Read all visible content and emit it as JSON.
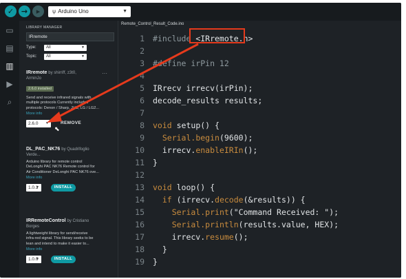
{
  "toolbar": {
    "board": "Arduino Uno",
    "verify_icon": "check-icon",
    "upload_icon": "arrow-right-icon",
    "debug_icon": "debug-icon"
  },
  "activity_bar": {
    "icons": [
      "folder-icon",
      "boards-icon",
      "library-icon",
      "debug-icon",
      "search-icon"
    ]
  },
  "library_manager": {
    "title": "LIBRARY MANAGER",
    "search_value": "IRremote",
    "type_label": "Type:",
    "type_value": "All",
    "topic_label": "Topic:",
    "topic_value": "All",
    "items": [
      {
        "name": "IRremote",
        "by": "by shirriff, z3t0,",
        "author2": "ArminJo",
        "badge": "2.6.0 installed",
        "desc1": "Send and receive infrared signals with",
        "desc2": "multiple protocols Currently included",
        "desc3": "protocols: Denon / Sharp, JVC, LG / LG2...",
        "more_info": "More info",
        "version": "2.6.0",
        "action": "REMOVE"
      },
      {
        "name": "DL_PAC_NK76",
        "by": "by Quadrifoglio",
        "author2": "Verde...",
        "desc1": "Arduino library for remote control",
        "desc2": "DeLonghi PAC NK76 Remote control for",
        "desc3": "Air Conditioner DeLonghi PAC NK76 ove...",
        "more_info": "More info",
        "version": "1.0.1",
        "action": "INSTALL"
      },
      {
        "name": "IRRemoteControl",
        "by": "by Cristiano",
        "author2": "Borges",
        "desc1": "A lightweight library for send/receive",
        "desc2": "infra-red signal. This library seeks to be",
        "desc3": "lean and intend to make it easier to...",
        "more_info": "More info",
        "version": "1.0.0",
        "action": "INSTALL"
      }
    ]
  },
  "editor": {
    "tab": "Remote_Control_Result_Code.ino",
    "line_numbers": [
      "1",
      "2",
      "3",
      "4",
      "5",
      "6",
      "7",
      "8",
      "9",
      "10",
      "11",
      "12",
      "13",
      "14",
      "15",
      "16",
      "17",
      "18",
      "19"
    ],
    "lines": {
      "l1_a": "#include ",
      "l1_b": "<IRremote.h>",
      "l3": "#define irPin 12",
      "l5": "IRrecv irrecv(irPin);",
      "l6": "decode_results results;",
      "l8_kw": "void",
      "l8_rest": " setup() {",
      "l9_a": "  ",
      "l9_fn": "Serial.begin",
      "l9_rest": "(9600);",
      "l10_a": "  irrecv.",
      "l10_fn": "enableIRIn",
      "l10_rest": "();",
      "l11": "}",
      "l13_kw": "void",
      "l13_rest": " loop() {",
      "l14_a": "  ",
      "l14_kw": "if",
      "l14_b": " (irrecv.",
      "l14_fn": "decode",
      "l14_rest": "(&results)) {",
      "l15_a": "    ",
      "l15_fn": "Serial.print",
      "l15_rest": "(\"Command Received: \");",
      "l16_a": "    ",
      "l16_fn": "Serial.println",
      "l16_rest": "(results.value, HEX);",
      "l17_a": "    irrecv.",
      "l17_fn": "resume",
      "l17_rest": "();",
      "l18": "  }",
      "l19": "}"
    }
  },
  "annotation": {
    "color": "#e63a1c"
  }
}
